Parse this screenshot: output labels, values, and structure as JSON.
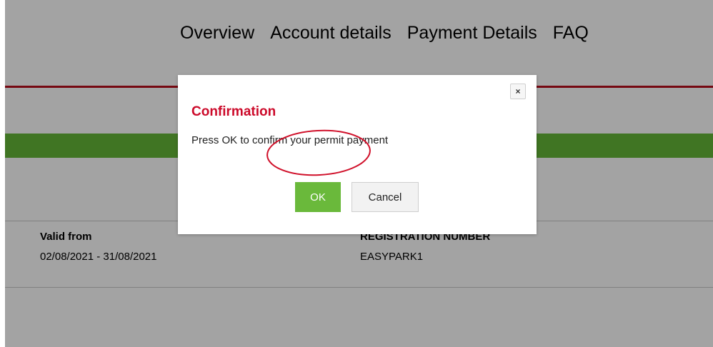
{
  "nav": {
    "items": [
      {
        "label": "Overview"
      },
      {
        "label": "Account details"
      },
      {
        "label": "Payment Details"
      },
      {
        "label": "FAQ"
      }
    ]
  },
  "permit": {
    "valid_from_label": "Valid from",
    "valid_from_value": "02/08/2021 - 31/08/2021",
    "registration_label": "REGISTRATION NUMBER",
    "registration_value": "EASYPARK1"
  },
  "modal": {
    "title": "Confirmation",
    "message": "Press OK to confirm your permit payment",
    "close_symbol": "×",
    "ok_label": "OK",
    "cancel_label": "Cancel"
  },
  "colors": {
    "title_red": "#cc0a2a",
    "header_rule": "#b70d1c",
    "green_bar": "#64b838",
    "ok_button": "#6ab93b",
    "annotation_circle": "#d0102a"
  }
}
